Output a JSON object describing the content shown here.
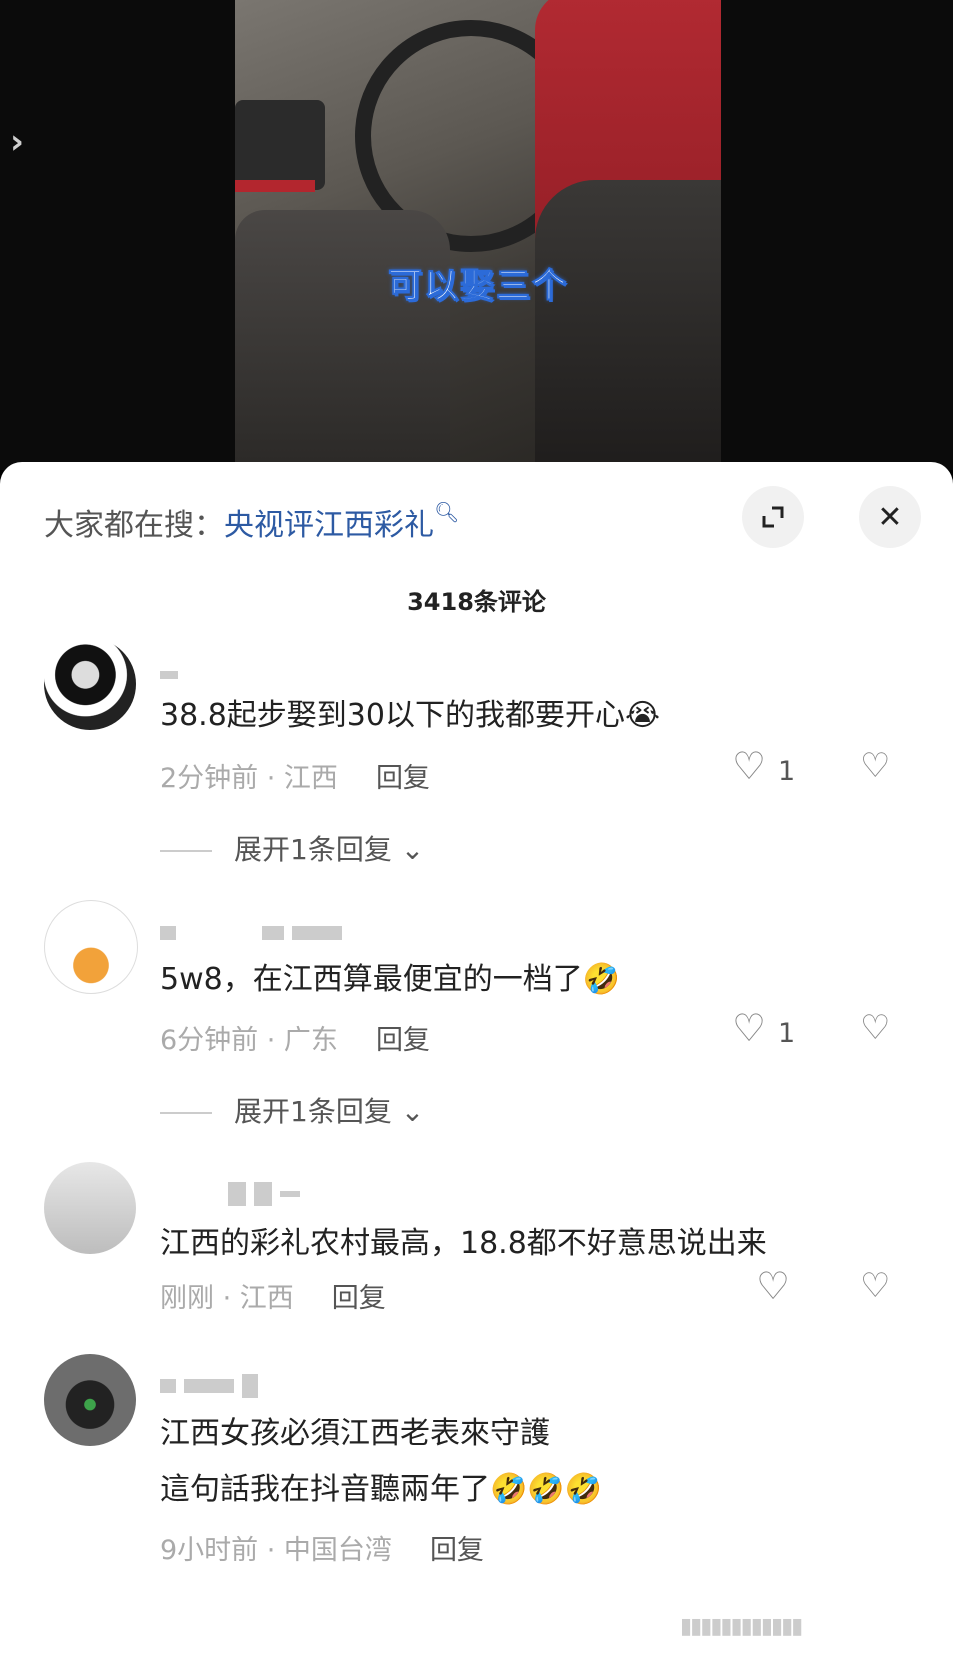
{
  "video": {
    "caption": "可以娶三个"
  },
  "search": {
    "prefix": "大家都在搜：",
    "term": "央视评江西彩礼"
  },
  "comments_count": "3418条评论",
  "comments": [
    {
      "text": "38.8起步娶到30以下的我都要开心😭",
      "time": "2分钟前 · 江西",
      "reply": "回复",
      "likes": "1",
      "expand": "展开1条回复"
    },
    {
      "text": "5w8，在江西算最便宜的一档了🤣",
      "time": "6分钟前 · 广东",
      "reply": "回复",
      "likes": "1",
      "expand": "展开1条回复"
    },
    {
      "text": "江西的彩礼农村最高，18.8都不好意思说出来",
      "time": "刚刚 · 江西",
      "reply": "回复",
      "likes": ""
    },
    {
      "text": "江西女孩必須江西老表來守護",
      "text2": "這句話我在抖音聽兩年了🤣🤣🤣",
      "time": "9小时前 · 中国台湾",
      "reply": "回复"
    }
  ]
}
